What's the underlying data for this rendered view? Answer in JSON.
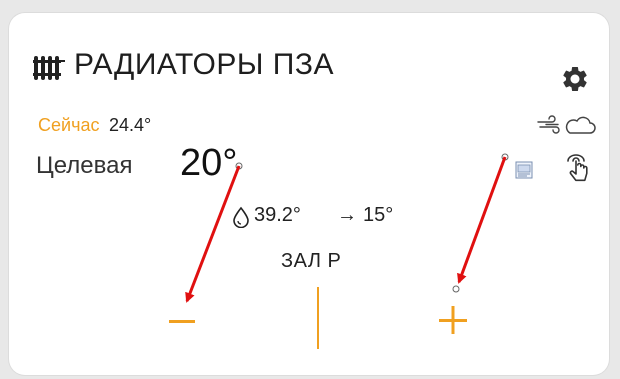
{
  "card": {
    "title": "РАДИАТОРЫ ПЗА",
    "now_label": "Сейчас",
    "now_value": "24.4°",
    "target_label": "Целевая",
    "target_value": "20°",
    "water_temp": "39.2°",
    "arrow": "→",
    "set_temp": "15°",
    "room": "ЗАЛ Р"
  },
  "colors": {
    "accent": "#f0a020",
    "annotation_arrow": "#e01010",
    "text": "#222222",
    "card_bg": "#ffffff"
  },
  "icons": {
    "title": "radiator-icon",
    "settings": "gear-icon",
    "weather": [
      "wind-icon",
      "cloud-icon"
    ],
    "schedule": "schedule-icon",
    "touch": "touch-icon",
    "water": "water-drop-icon",
    "decrease": "minus-icon",
    "increase": "plus-icon"
  }
}
